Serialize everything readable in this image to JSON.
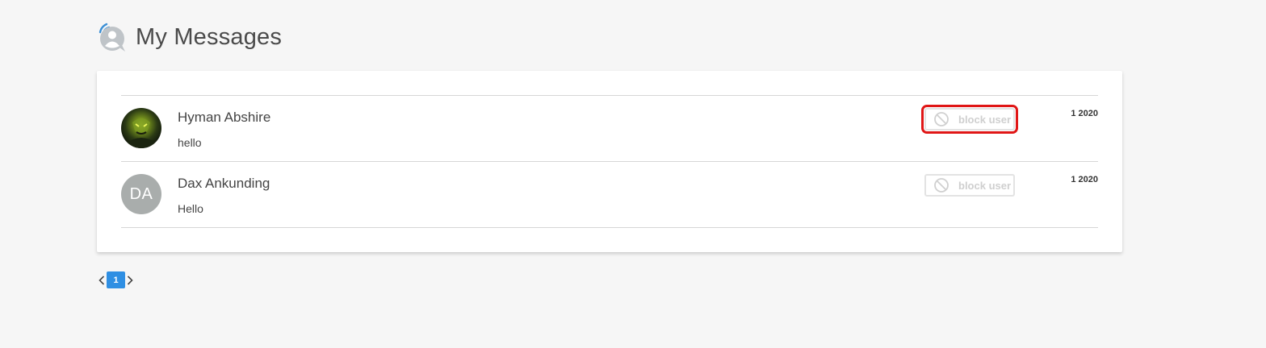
{
  "header": {
    "title": "My Messages",
    "icon": "chat-user-icon"
  },
  "messages": [
    {
      "name": "Hyman Abshire",
      "text": "hello",
      "date": "1 2020",
      "avatar_type": "photo",
      "action_label": "block user"
    },
    {
      "name": "Dax Ankunding",
      "text": "Hello",
      "date": "1 2020",
      "avatar_type": "initials",
      "avatar_initials": "DA",
      "action_label": "block user"
    }
  ],
  "pagination": {
    "current_page": "1"
  },
  "colors": {
    "accent": "#2f8fe3",
    "highlight": "#e01616",
    "avatar_initials_bg": "#a9adac"
  }
}
